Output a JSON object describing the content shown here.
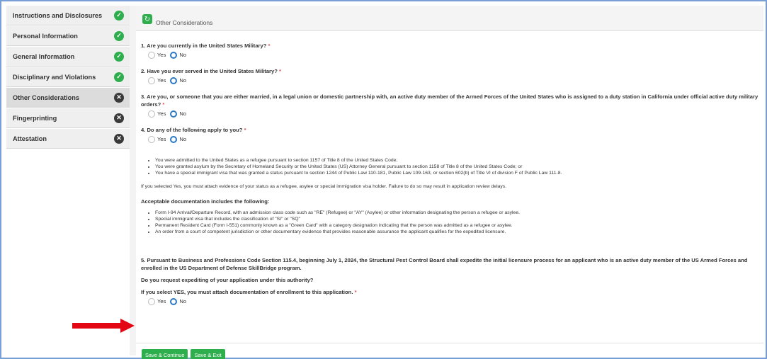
{
  "sidebar": {
    "items": [
      {
        "label": "Instructions and Disclosures",
        "status": "complete"
      },
      {
        "label": "Personal Information",
        "status": "complete"
      },
      {
        "label": "General Information",
        "status": "complete"
      },
      {
        "label": "Disciplinary and Violations",
        "status": "complete"
      },
      {
        "label": "Other Considerations",
        "status": "incomplete",
        "active": true
      },
      {
        "label": "Fingerprinting",
        "status": "incomplete"
      },
      {
        "label": "Attestation",
        "status": "incomplete"
      }
    ]
  },
  "header": {
    "title": "Other Considerations",
    "icon": "refresh-icon"
  },
  "questions": {
    "q1": "1. Are you currently in the United States Military?",
    "q2": "2. Have you ever served in the United States Military?",
    "q3": "3. Are you, or someone that you are either married, in a legal union or domestic partnership with, an active duty member of the Armed Forces of the United States who is assigned to a duty station in California under official active duty military orders?",
    "q4": "4. Do any of the following apply to you?",
    "q5": "5. Pursuant to Business and Professions Code Section 115.4, beginning July 1, 2024, the Structural Pest Control Board shall expedite the initial licensure process for an applicant who is an active duty member of the US Armed Forces and enrolled in the US Department of Defense SkillBridge program.",
    "q5_sub1": "Do you request expediting of your application under this authority?",
    "q5_sub2": "If you select YES, you must attach documentation of enrollment to this application.",
    "required_mark": "*"
  },
  "radio": {
    "yes_label": "Yes",
    "no_label": "No",
    "selected": "No"
  },
  "q4_bullets": [
    "You were admitted to the United States as a refugee pursuant to section 1157 of Title 8 of the United States Code;",
    "You were granted asylum by the Secretary of Homeland Security or the United States (US) Attorney General pursuant to section 1158 of Title 8 of the United States Code; or",
    "You have a special immigrant visa that was granted a status pursuant to section 1244 of Public Law 110-181, Public Law 109-163, or section 602(b) of Title VI of division F of Public Law 111-8."
  ],
  "q4_note": "If you selected Yes, you must attach evidence of your status as a refugee, asylee or special immigration visa holder. Failure to do so may result in application review delays.",
  "docs_heading": "Acceptable documentation includes the following:",
  "docs_bullets": [
    "Form I-94 Arrival/Departure Record, with an admission class code such as \"RE\" (Refugee) or \"AY\" (Asylee) or other information designating the person a refugee or asylee.",
    "Special immigrant visa that includes the classification of \"SI\" or \"SQ\"",
    "Permanent Resident Card (Form I-551) commonly known as a \"Green Card\" with a category designation indicating that the person was admitted as a refugee or asylee.",
    "An order from a court of competent jurisdiction or other documentary evidence that provides reasonable assurance the applicant qualifies for the expedited licensure."
  ],
  "footer": {
    "save_continue": "Save & Continue",
    "save_exit": "Save & Exit"
  },
  "colors": {
    "accent": "#2fae4e",
    "radio_selected": "#2b78c5",
    "arrow": "#e30613",
    "frame": "#7a9fd6"
  }
}
